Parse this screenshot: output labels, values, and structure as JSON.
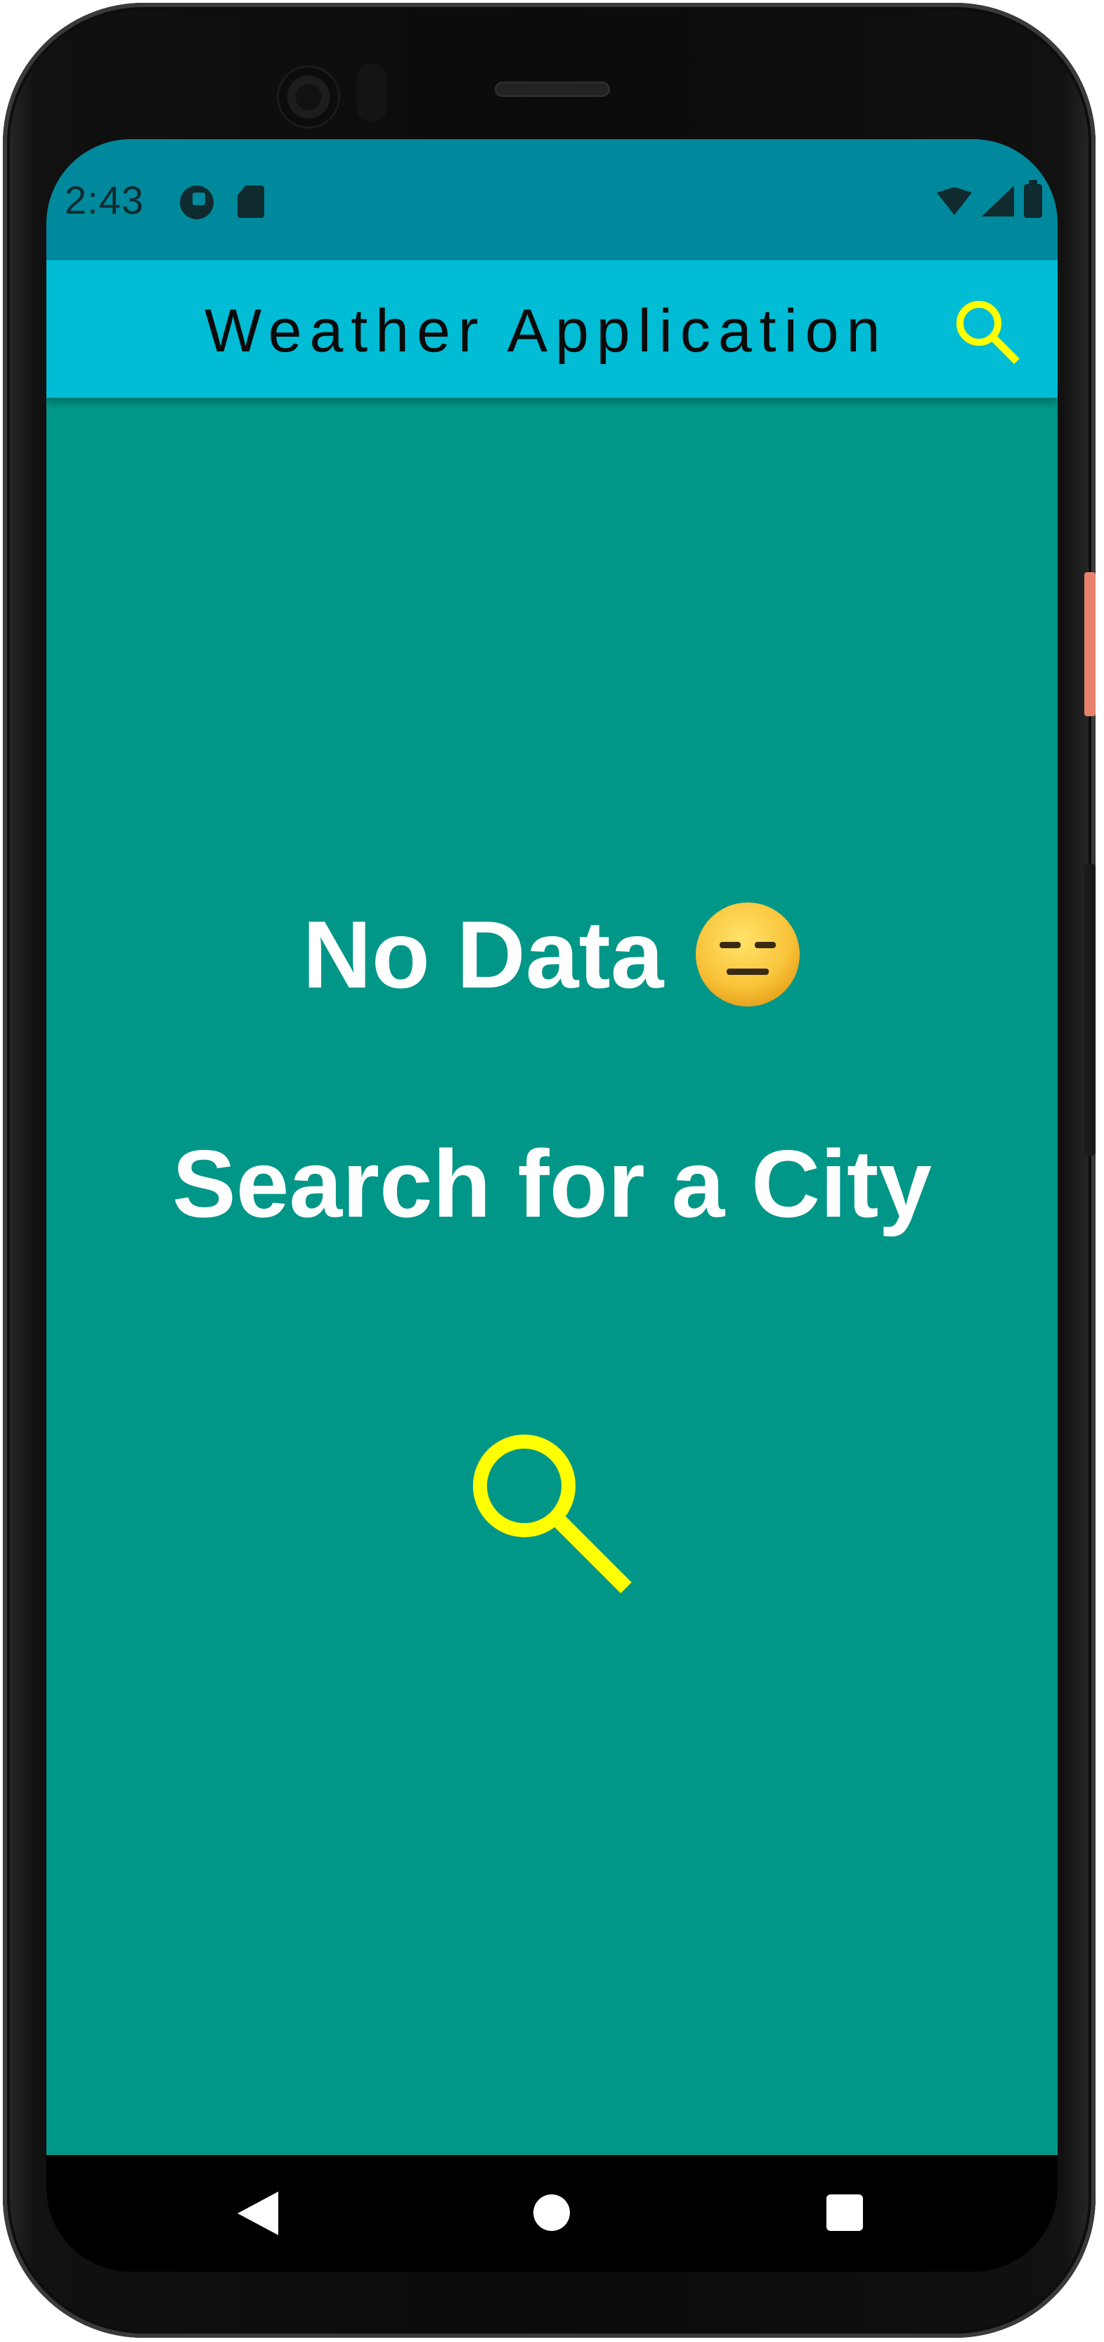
{
  "status_bar": {
    "time": "2:43",
    "icons": [
      "app-notification-icon",
      "sd-card-icon",
      "wifi-icon",
      "signal-icon",
      "battery-icon"
    ]
  },
  "app_bar": {
    "title": "Weather Application",
    "search_icon": "search-icon",
    "background_color": "#00bcd4",
    "icon_color": "#ffff00"
  },
  "main": {
    "no_data_text": "No Data",
    "no_data_emoji": "expressionless-face-icon",
    "prompt_text": "Search for a City",
    "search_icon": "search-icon",
    "background_color": "#009688",
    "text_color": "#ffffff"
  },
  "nav_bar": {
    "buttons": [
      "back-icon",
      "home-icon",
      "recents-icon"
    ]
  }
}
